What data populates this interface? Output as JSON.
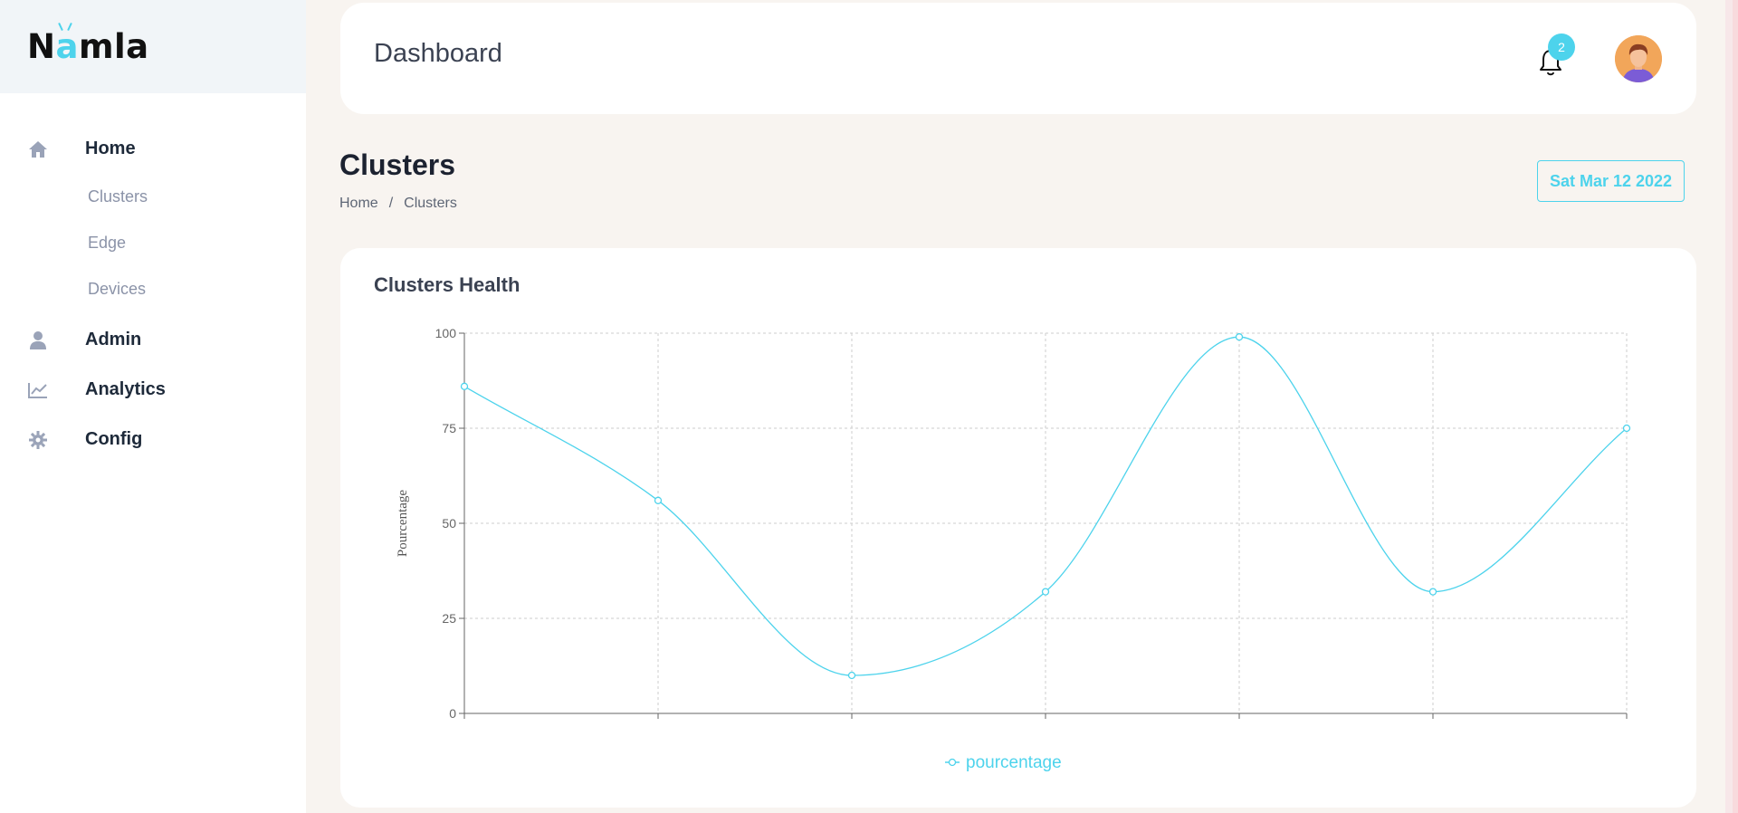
{
  "brand": {
    "name_prefix": "N",
    "name_accent": "a",
    "name_suffix": "mla"
  },
  "sidebar": {
    "items": [
      {
        "label": "Home",
        "icon": "home-icon"
      },
      {
        "label": "Admin",
        "icon": "user-icon"
      },
      {
        "label": "Analytics",
        "icon": "chart-line-icon"
      },
      {
        "label": "Config",
        "icon": "gear-icon"
      }
    ],
    "home_sub": [
      "Clusters",
      "Edge",
      "Devices"
    ]
  },
  "header": {
    "title": "Dashboard",
    "notifications": "2"
  },
  "page": {
    "title": "Clusters",
    "breadcrumb": {
      "home": "Home",
      "separator": "/",
      "current": "Clusters"
    },
    "date": "Sat Mar 12 2022"
  },
  "card": {
    "title": "Clusters Health"
  },
  "colors": {
    "accent": "#4dd3ec",
    "background": "#f8f4f0"
  },
  "chart_data": {
    "type": "line",
    "x": [
      1,
      2,
      3,
      4,
      5,
      6,
      7
    ],
    "series": [
      {
        "name": "pourcentage",
        "values": [
          86,
          56,
          10,
          32,
          99,
          32,
          75
        ]
      }
    ],
    "ylabel": "Pourcentage",
    "yticks": [
      "0",
      "25",
      "50",
      "75",
      "100"
    ],
    "ylim": [
      0,
      100
    ],
    "grid": true,
    "legend": "bottom-center"
  }
}
